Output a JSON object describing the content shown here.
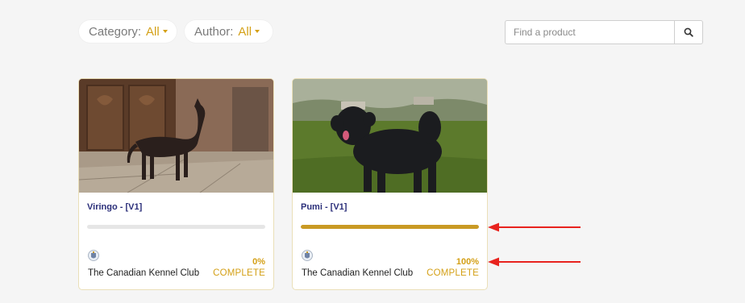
{
  "filters": {
    "category": {
      "label": "Category:",
      "value": "All"
    },
    "author": {
      "label": "Author:",
      "value": "All"
    }
  },
  "search": {
    "placeholder": "Find a product",
    "button_icon": "search-icon"
  },
  "cards": [
    {
      "title": "Viringo - [V1]",
      "progress": 0,
      "percent_label": "0%",
      "organization": "The Canadian Kennel Club",
      "status": "COMPLETE",
      "image": "hairless-dog-photo"
    },
    {
      "title": "Pumi - [V1]",
      "progress": 100,
      "percent_label": "100%",
      "organization": "The Canadian Kennel Club",
      "status": "COMPLETE",
      "image": "curly-black-dog-photo"
    }
  ],
  "colors": {
    "accent": "#d4a017",
    "progress_fill": "#c99a24",
    "title": "#2b2f7a",
    "annotation_arrow": "#e8231e"
  }
}
